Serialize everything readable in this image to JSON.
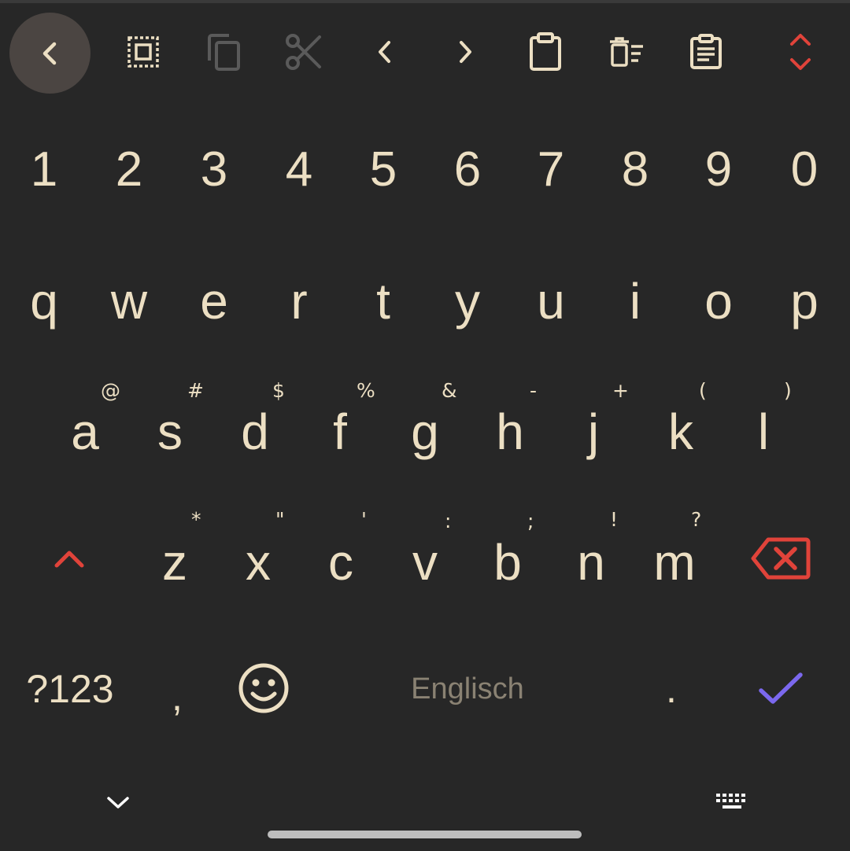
{
  "toolbar": {
    "buttons": [
      {
        "name": "back-arrow-icon",
        "enabled": true
      },
      {
        "name": "select-all-icon",
        "enabled": true
      },
      {
        "name": "copy-icon",
        "enabled": false
      },
      {
        "name": "cut-icon",
        "enabled": false
      },
      {
        "name": "cursor-left-icon",
        "enabled": true
      },
      {
        "name": "cursor-right-icon",
        "enabled": true
      },
      {
        "name": "paste-icon",
        "enabled": true
      },
      {
        "name": "clear-clipboard-icon",
        "enabled": true
      },
      {
        "name": "clipboard-history-icon",
        "enabled": true
      },
      {
        "name": "expand-collapse-icon",
        "enabled": true
      }
    ]
  },
  "keyboard": {
    "number_row": [
      "1",
      "2",
      "3",
      "4",
      "5",
      "6",
      "7",
      "8",
      "9",
      "0"
    ],
    "row1": [
      "q",
      "w",
      "e",
      "r",
      "t",
      "y",
      "u",
      "i",
      "o",
      "p"
    ],
    "row2": [
      {
        "key": "a",
        "hint": "@"
      },
      {
        "key": "s",
        "hint": "#"
      },
      {
        "key": "d",
        "hint": "$"
      },
      {
        "key": "f",
        "hint": "%"
      },
      {
        "key": "g",
        "hint": "&"
      },
      {
        "key": "h",
        "hint": "-"
      },
      {
        "key": "j",
        "hint": "+"
      },
      {
        "key": "k",
        "hint": "("
      },
      {
        "key": "l",
        "hint": ")"
      }
    ],
    "row3": [
      {
        "key": "z",
        "hint": "*"
      },
      {
        "key": "x",
        "hint": "\""
      },
      {
        "key": "c",
        "hint": "'"
      },
      {
        "key": "v",
        "hint": ":"
      },
      {
        "key": "b",
        "hint": ";"
      },
      {
        "key": "n",
        "hint": "!"
      },
      {
        "key": "m",
        "hint": "?"
      }
    ],
    "symbols_label": "?123",
    "comma_label": ",",
    "space_label": "Englisch",
    "period_label": ".",
    "shift_icon": "shift-icon",
    "backspace_icon": "backspace-icon",
    "emoji_icon": "emoji-icon",
    "enter_icon": "checkmark-icon"
  },
  "navbar": {
    "hide_icon": "chevron-down-icon",
    "switch_icon": "keyboard-icon"
  },
  "colors": {
    "background": "#272727",
    "key_text": "#ecdfc3",
    "accent_red": "#e0433a",
    "accent_purple": "#7b68ee",
    "disabled": "#5a5a5a",
    "back_button_bg": "#4b4542"
  }
}
